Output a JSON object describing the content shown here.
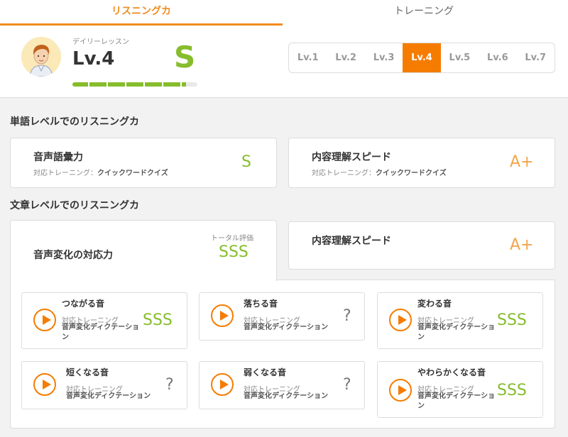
{
  "tabs": [
    {
      "label": "リスニングカ",
      "active": true
    },
    {
      "label": "トレーニング",
      "active": false
    }
  ],
  "header": {
    "lesson_label": "デイリーレッスン",
    "level": "Lv.4",
    "rank": "S",
    "progress_fraction": 0.91,
    "levels": [
      "Lv.1",
      "Lv.2",
      "Lv.3",
      "Lv.4",
      "Lv.5",
      "Lv.6",
      "Lv.7"
    ],
    "active_level_index": 3
  },
  "word_section": {
    "title": "単語レベルでのリスニングカ",
    "cards": [
      {
        "title": "音声語彙力",
        "sub_label": "対応トレーニング：",
        "sub_value": "クイックワードクイズ",
        "grade": "S"
      },
      {
        "title": "内容理解スピード",
        "sub_label": "対応トレーニング：",
        "sub_value": "クイックワードクイズ",
        "grade": "A+"
      }
    ]
  },
  "sentence_section": {
    "title": "文章レベルでのリスニングカ",
    "change_card": {
      "title": "音声変化の対応力",
      "total_label": "トータル評価",
      "grade": "SSS"
    },
    "speed_card": {
      "title": "内容理解スピード",
      "grade": "A+"
    },
    "sub_cards": [
      {
        "title": "つながる音",
        "training_label": "対応トレーニング",
        "training_name": "音声変化ディクテーション",
        "grade": "SSS"
      },
      {
        "title": "落ちる音",
        "training_label": "対応トレーニング",
        "training_name": "音声変化ディクテーション",
        "grade": "?"
      },
      {
        "title": "変わる音",
        "training_label": "対応トレーニング",
        "training_name": "音声変化ディクテーション",
        "grade": "SSS"
      },
      {
        "title": "短くなる音",
        "training_label": "対応トレーニング",
        "training_name": "音声変化ディクテーション",
        "grade": "?"
      },
      {
        "title": "弱くなる音",
        "training_label": "対応トレーニング",
        "training_name": "音声変化ディクテーション",
        "grade": "?"
      },
      {
        "title": "やわらかくなる音",
        "training_label": "対応トレーニング",
        "training_name": "音声変化ディクテーション",
        "grade": "SSS"
      }
    ]
  },
  "colors": {
    "accent": "#f57c00",
    "grade_green": "#86bd2c",
    "grade_orange": "#f0a64b"
  }
}
